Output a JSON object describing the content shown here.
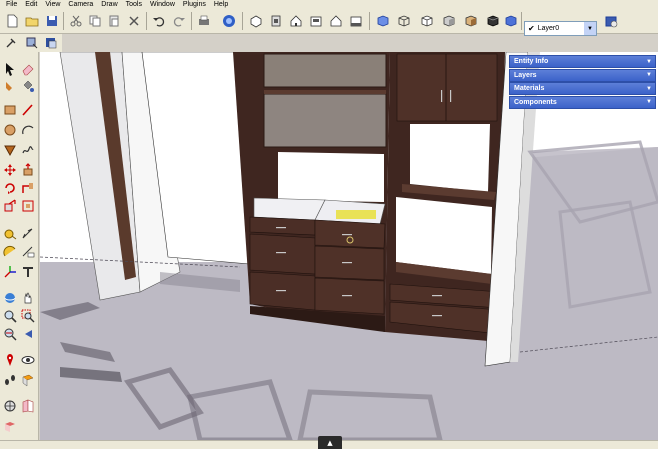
{
  "menu": [
    "File",
    "Edit",
    "View",
    "Camera",
    "Draw",
    "Tools",
    "Window",
    "Plugins",
    "Help"
  ],
  "layer": {
    "selected": "Layer0"
  },
  "tray": {
    "items": [
      "Entity Info",
      "Layers",
      "Materials",
      "Components"
    ]
  },
  "toolbar_top_icons": [
    "new-icon",
    "open-icon",
    "save-icon",
    "cut-icon",
    "copy-icon",
    "paste-icon",
    "erase-icon",
    "undo-icon",
    "redo-icon",
    "print-icon",
    "model-info-icon",
    "iso-view-icon",
    "top-view-icon",
    "front-view-icon",
    "right-view-icon",
    "back-view-icon",
    "left-view-icon",
    "xray-icon",
    "wireframe-icon",
    "hidden-line-icon",
    "shaded-icon",
    "shaded-texture-icon",
    "monochrome-icon",
    "layer-manager-icon"
  ],
  "toolbar_left_icons": [
    "select-icon",
    "eraser-icon",
    "rectangle-icon",
    "line-icon",
    "circle-icon",
    "arc-icon",
    "polygon-icon",
    "freehand-icon",
    "move-icon",
    "pushpull-icon",
    "rotate-icon",
    "followme-icon",
    "scale-icon",
    "offset-icon",
    "tape-icon",
    "dimension-icon",
    "protractor-icon",
    "text-icon",
    "axes-icon",
    "3dtext-icon",
    "orbit-icon",
    "pan-icon",
    "zoom-icon",
    "zoom-window-icon",
    "zoom-extents-icon",
    "previous-icon",
    "position-camera-icon",
    "walk-icon",
    "lookaround-icon",
    "section-icon"
  ],
  "colors": {
    "chrome": "#ece9d8",
    "tray_blue": "#3b62c9",
    "cabinet_wood": "#4a2d24",
    "ground": "#bfbcc6"
  }
}
